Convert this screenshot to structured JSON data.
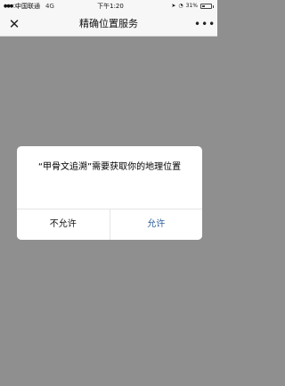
{
  "status_bar": {
    "carrier": "中国联通",
    "network": "4G",
    "time": "下午1:20",
    "battery_percent": "31%"
  },
  "nav": {
    "title": "精确位置服务"
  },
  "dialog": {
    "message": "“甲骨文追溯”需要获取你的地理位置",
    "deny_label": "不允许",
    "allow_label": "允许"
  },
  "colors": {
    "overlay": "#8f8f8f",
    "bar_background": "#f7f7f7",
    "allow_text": "#2d5e9e"
  }
}
